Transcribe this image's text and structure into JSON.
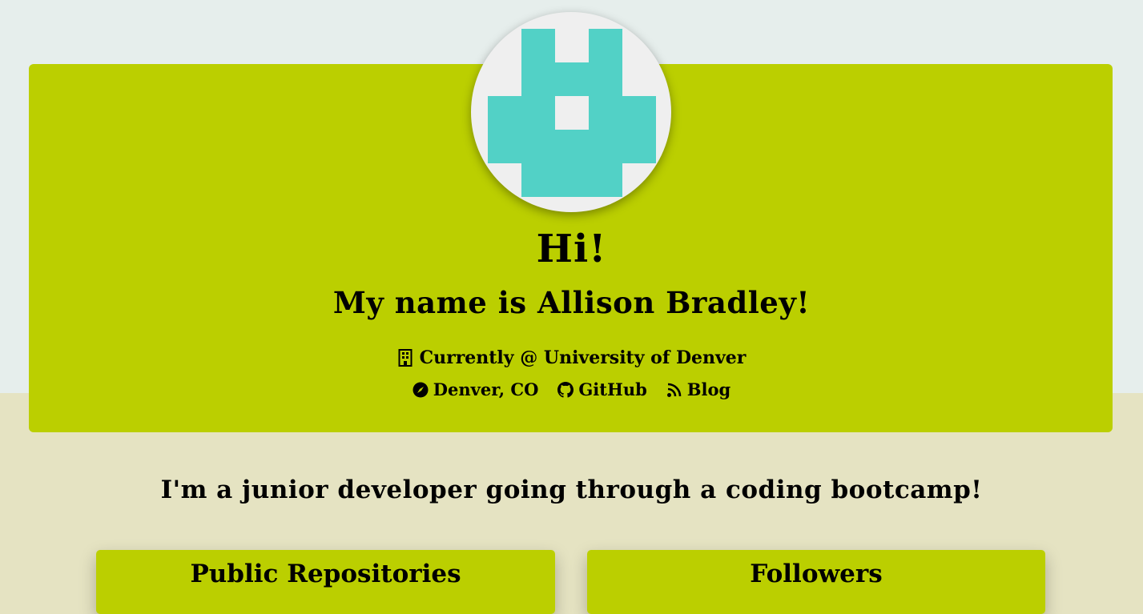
{
  "profile": {
    "greeting": "Hi!",
    "name_line": "My name is Allison Bradley!",
    "workplace": "Currently @ University of Denver",
    "bio": "I'm a junior developer going through a coding bootcamp!"
  },
  "links": {
    "location": "Denver, CO",
    "github": "GitHub",
    "blog": "Blog"
  },
  "cards": {
    "repos_title": "Public Repositories",
    "followers_title": "Followers"
  },
  "icons": {
    "workplace": "building-icon",
    "location": "compass-icon",
    "github": "github-icon",
    "blog": "rss-icon",
    "avatar": "identicon-avatar"
  },
  "colors": {
    "page_top": "#e6eeec",
    "page_bottom": "#e5e3c2",
    "card": "#bbcf00",
    "avatar_bg": "#efefef",
    "identicon": "#52d1c6"
  }
}
